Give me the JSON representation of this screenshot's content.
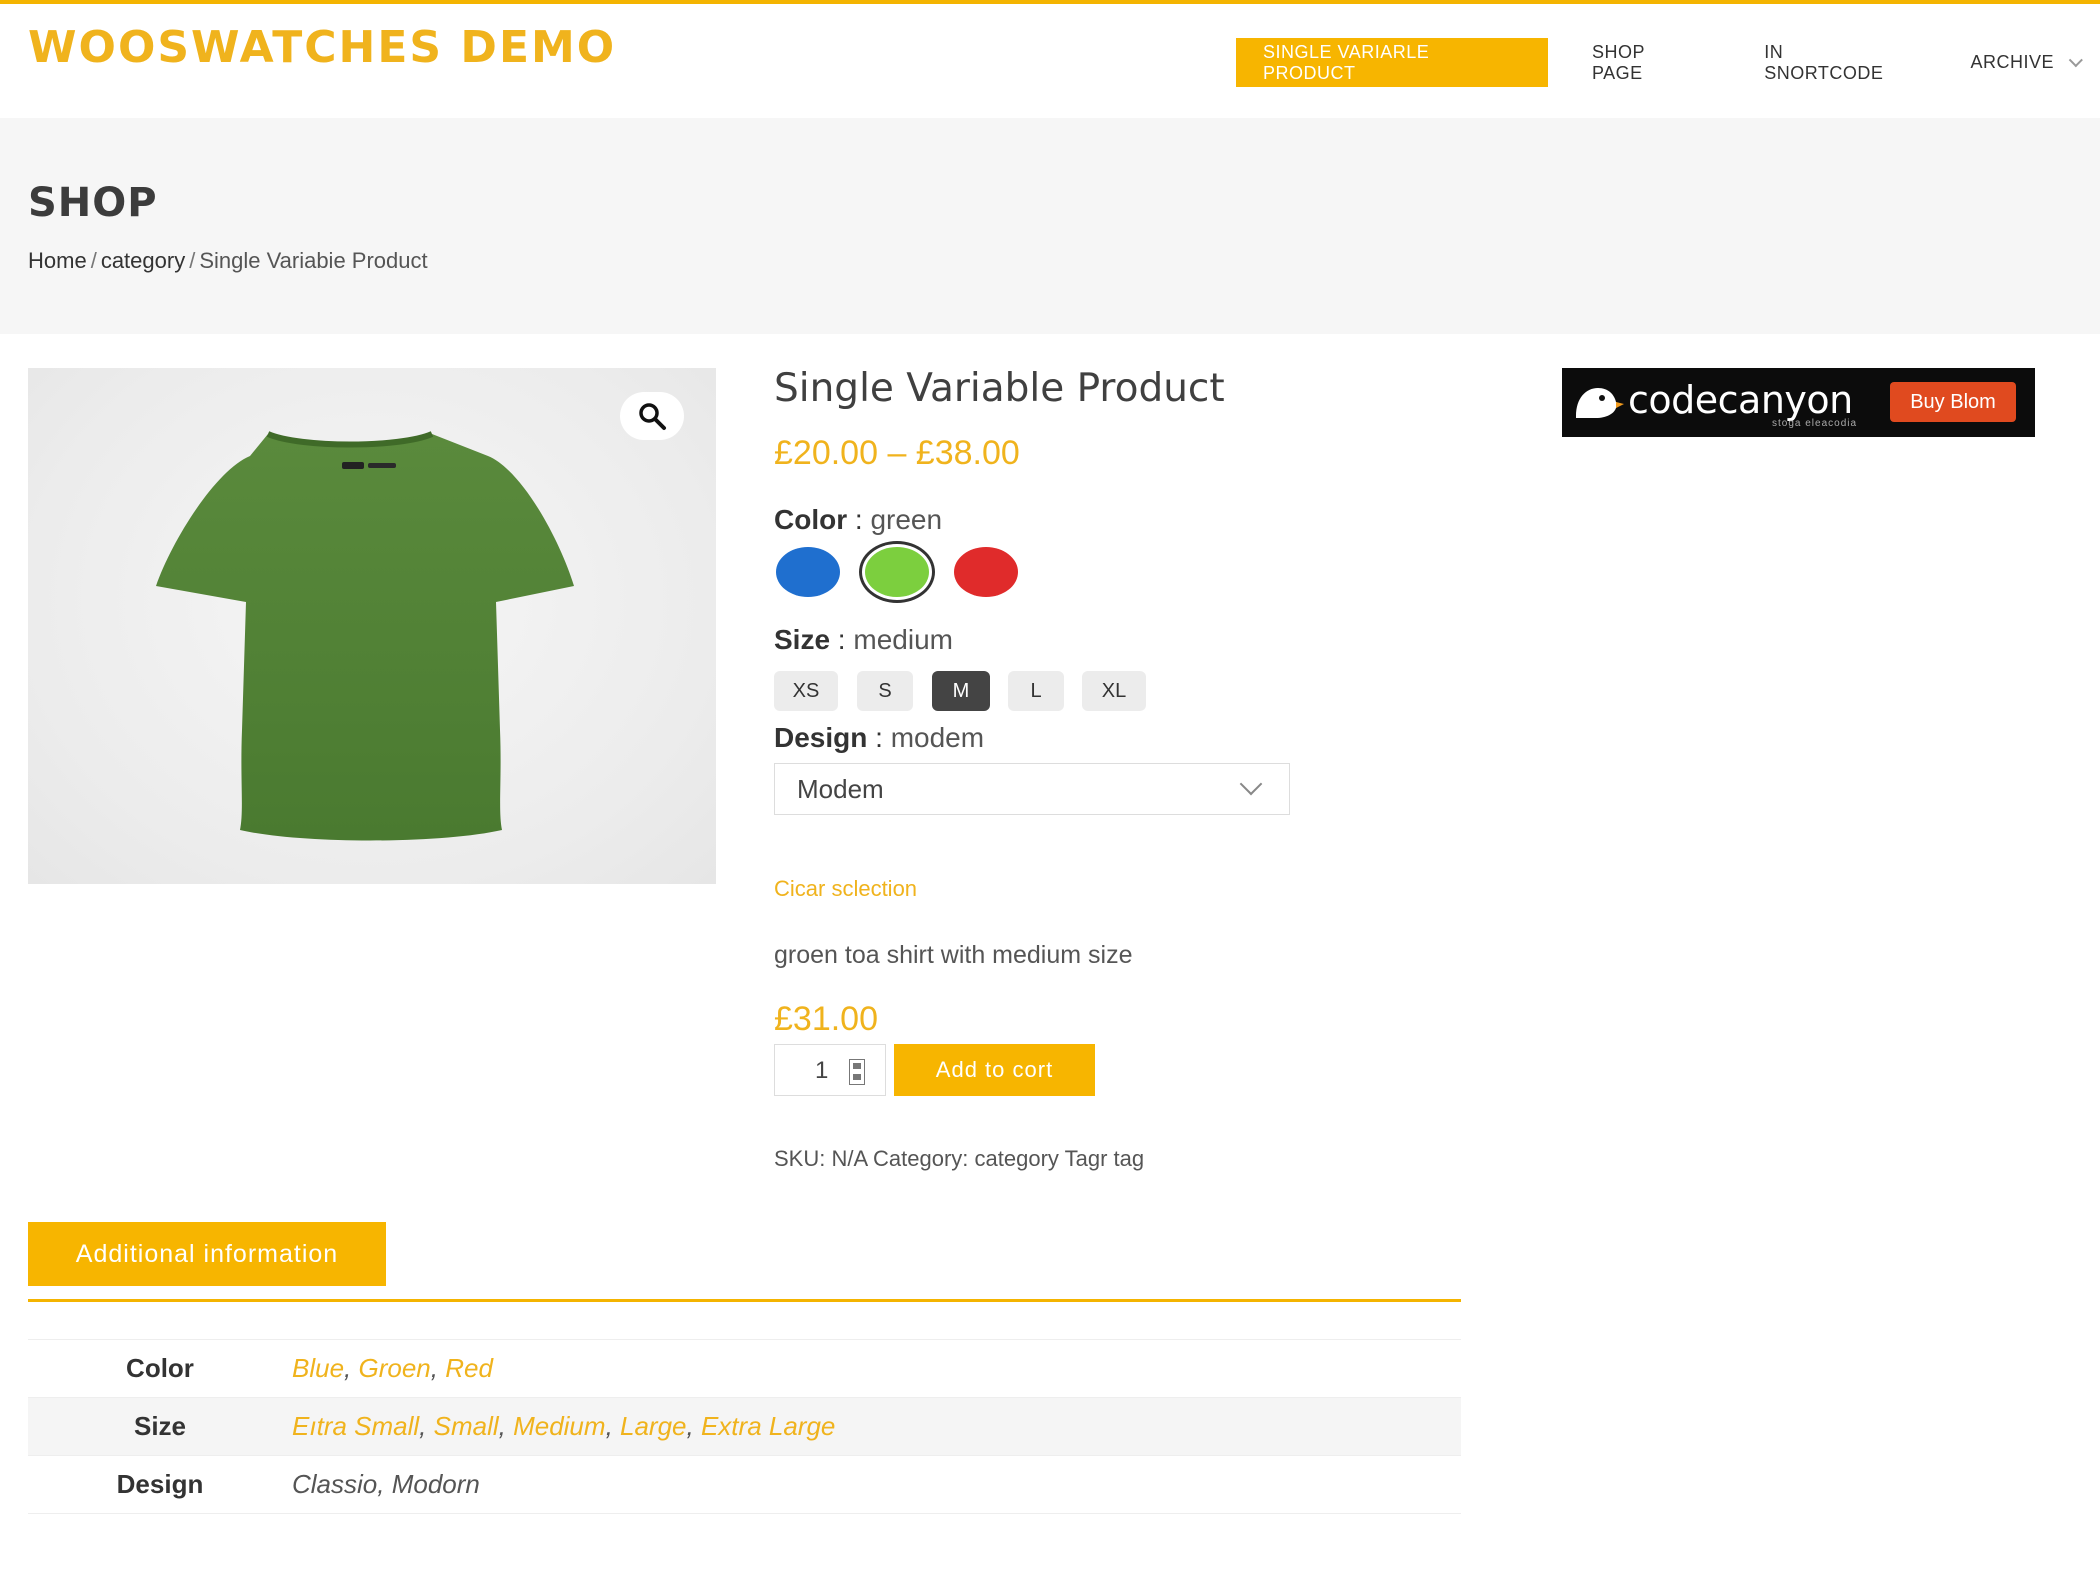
{
  "site": {
    "title": "WOOSWATCHES DEMO"
  },
  "nav": {
    "items": [
      {
        "label": "SINGLE VARIARLE PRODUCT",
        "active": true
      },
      {
        "label": "SHOP PAGE",
        "active": false
      },
      {
        "label": "IN SNORTCODE",
        "active": false
      },
      {
        "label": "ARCHIVE",
        "active": false,
        "has_dropdown": true
      }
    ]
  },
  "page": {
    "title": "SHOP",
    "breadcrumb": {
      "home": "Home",
      "sep": "/",
      "category": "category",
      "current": "Single Variabie Product"
    }
  },
  "product": {
    "title": "Single Variable Product",
    "price_range": "£20.00 – £38.00",
    "color": {
      "label": "Color",
      "separator": " : ",
      "value": "green",
      "swatches": [
        {
          "name": "blue",
          "hex": "#1f6fcf",
          "selected": false
        },
        {
          "name": "green",
          "hex": "#7ccf3e",
          "selected": true
        },
        {
          "name": "red",
          "hex": "#e02b2b",
          "selected": false
        }
      ]
    },
    "size": {
      "label": "Size",
      "separator": " : ",
      "value": "medium",
      "options": [
        {
          "label": "XS",
          "selected": false
        },
        {
          "label": "S",
          "selected": false
        },
        {
          "label": "M",
          "selected": true
        },
        {
          "label": "L",
          "selected": false
        },
        {
          "label": "XL",
          "selected": false
        }
      ]
    },
    "design": {
      "label": "Design",
      "separator": " : ",
      "value": "modem",
      "selected_option": "Modem"
    },
    "clear_selection": "Cicar sclection",
    "variation_description": "groen toa shirt with medium size",
    "variation_price": "£31.00",
    "quantity": "1",
    "add_to_cart": "Add to cort",
    "meta": "SKU: N/A Category: category Tagr tag",
    "zoom_icon": "search-icon"
  },
  "ad": {
    "brand": "codecanyon",
    "subtext": "stoga eleacodia",
    "button": "Buy Blom"
  },
  "tabs": {
    "active": "Additional information"
  },
  "attributes": [
    {
      "name": "Color",
      "values": [
        "Blue",
        "Groen",
        "Red"
      ],
      "linked": true
    },
    {
      "name": "Size",
      "values": [
        "Eıtra Small",
        "Small",
        "Medium",
        "Large",
        "Extra Large"
      ],
      "linked": true
    },
    {
      "name": "Design",
      "values": [
        "Classio",
        "Modorn"
      ],
      "linked": false
    }
  ],
  "colors": {
    "accent": "#f7b500",
    "title": "#f0b31d"
  }
}
